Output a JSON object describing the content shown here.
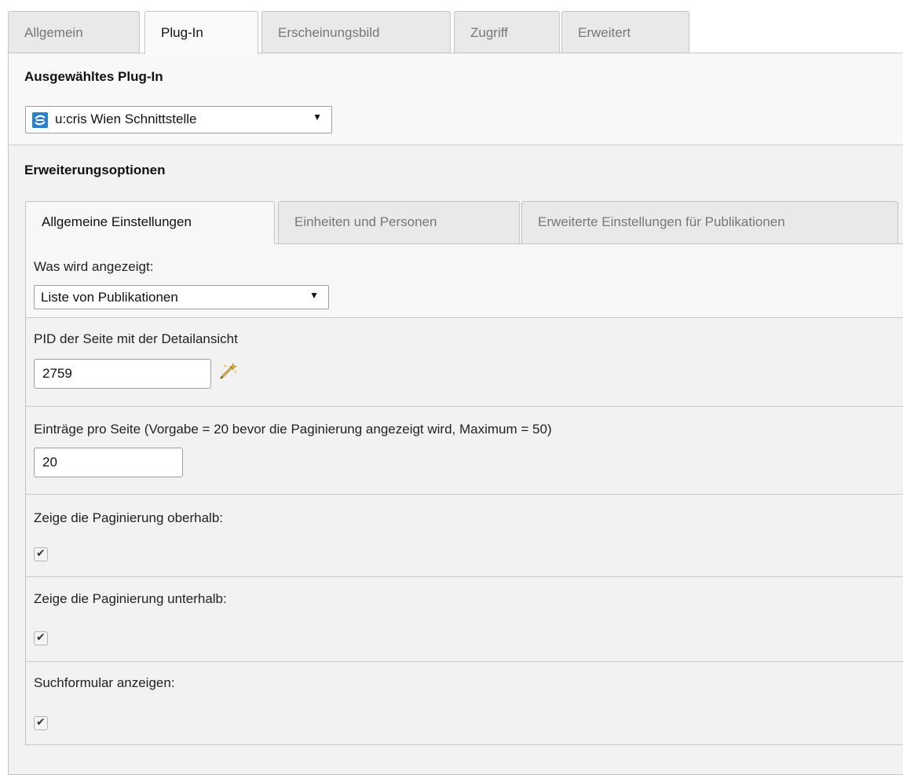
{
  "top_tabs": [
    {
      "label": "Allgemein",
      "active": false
    },
    {
      "label": "Plug-In",
      "active": true
    },
    {
      "label": "Erscheinungsbild",
      "active": false
    },
    {
      "label": "Zugriff",
      "active": false
    },
    {
      "label": "Erweitert",
      "active": false
    }
  ],
  "plugin_section": {
    "title": "Ausgewähltes Plug-In",
    "selected_plugin": "u:cris Wien Schnittstelle",
    "plugin_icon": "ucris-plugin-icon",
    "dropdown_arrow": "▼"
  },
  "extension_section": {
    "title": "Erweiterungsoptionen",
    "tabs": [
      {
        "label": "Allgemeine Einstellungen",
        "active": true
      },
      {
        "label": "Einheiten und Personen",
        "active": false
      },
      {
        "label": "Erweiterte Einstellungen für Publikationen",
        "active": false
      }
    ]
  },
  "fields": {
    "display_mode": {
      "label": "Was wird angezeigt:",
      "value": "Liste von Publikationen",
      "arrow": "▼"
    },
    "detail_pid": {
      "label": "PID der Seite mit der Detailansicht",
      "value": "2759",
      "wizard_icon": "wand-icon"
    },
    "items_per_page": {
      "label": "Einträge pro Seite (Vorgabe = 20 bevor die Paginierung angezeigt wird, Maximum = 50)",
      "value": "20"
    },
    "pagination_top": {
      "label": "Zeige die Paginierung oberhalb:",
      "checked": true,
      "mark": "✔"
    },
    "pagination_bottom": {
      "label": "Zeige die Paginierung unterhalb:",
      "checked": true,
      "mark": "✔"
    },
    "search_form": {
      "label": "Suchformular anzeigen:",
      "checked": true,
      "mark": "✔"
    }
  },
  "colors": {
    "accent_blue": "#2a7fd1",
    "panel_bg": "#f2f2f2",
    "border": "#c4c4c4"
  }
}
